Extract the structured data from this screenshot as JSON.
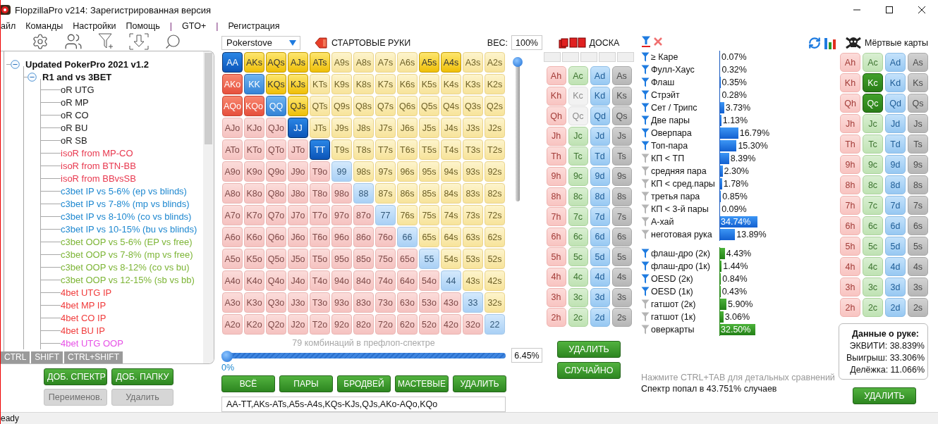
{
  "window": {
    "title": "FlopzillaPro v214: Зарегистрированная версия"
  },
  "menu": [
    {
      "label": "айл",
      "kind": "item"
    },
    {
      "label": "Команды",
      "kind": "item"
    },
    {
      "label": "Настройки",
      "kind": "item"
    },
    {
      "label": "Помощь",
      "kind": "item"
    },
    {
      "label": "|",
      "kind": "separator"
    },
    {
      "label": "GTO+",
      "kind": "item"
    },
    {
      "label": "|",
      "kind": "separator"
    },
    {
      "label": "Регистрация",
      "kind": "item"
    }
  ],
  "tree": {
    "nodes": [
      {
        "label": "Updated PokerPro 2021 v1.2",
        "kind": "folder",
        "expanded": true,
        "children": [
          {
            "label": "R1 and vs 3BET",
            "kind": "folder",
            "expanded": true,
            "children": [
              {
                "label": "oR UTG",
                "kind": "range",
                "color": "#1a1a1a"
              },
              {
                "label": "oR MP",
                "kind": "range",
                "color": "#1a1a1a"
              },
              {
                "label": "oR CO",
                "kind": "range",
                "color": "#1a1a1a"
              },
              {
                "label": "oR BU",
                "kind": "range",
                "color": "#1a1a1a"
              },
              {
                "label": "oR SB",
                "kind": "range",
                "color": "#1a1a1a"
              },
              {
                "label": "isoR from MP-CO",
                "kind": "range",
                "color": "#e8384f"
              },
              {
                "label": "isoR from BTN-BB",
                "kind": "range",
                "color": "#e8384f"
              },
              {
                "label": "isoR from BBvsSB",
                "kind": "range",
                "color": "#e8384f"
              },
              {
                "label": "c3bet IP vs 5-6% (ep vs blinds)",
                "kind": "range",
                "color": "#1e88d0"
              },
              {
                "label": "c3bet IP vs 7-8% (mp vs blinds)",
                "kind": "range",
                "color": "#1e88d0"
              },
              {
                "label": "c3bet IP vs 8-10% (co vs blinds)",
                "kind": "range",
                "color": "#1e88d0"
              },
              {
                "label": "c3bet IP vs 10-15% (bu vs blinds)",
                "kind": "range",
                "color": "#1e88d0"
              },
              {
                "label": "c3bet OOP vs 5-6% (EP vs free)",
                "kind": "range",
                "color": "#7db536"
              },
              {
                "label": "c3bet OOP vs 7-8% (mp vs free)",
                "kind": "range",
                "color": "#7db536"
              },
              {
                "label": "c3bet OOP vs 8-12% (co vs bu)",
                "kind": "range",
                "color": "#7db536"
              },
              {
                "label": "c3bet OOP vs 12-15% (sb vs bb)",
                "kind": "range",
                "color": "#7db536"
              },
              {
                "label": "4bet UTG IP",
                "kind": "range",
                "color": "#f03c3c"
              },
              {
                "label": "4bet MP IP",
                "kind": "range",
                "color": "#f03c3c"
              },
              {
                "label": "4bet CO IP",
                "kind": "range",
                "color": "#f03c3c"
              },
              {
                "label": "4bet BU IP",
                "kind": "range",
                "color": "#f03c3c"
              },
              {
                "label": "4bet UTG OOP",
                "kind": "range",
                "color": "#e650e6"
              }
            ]
          }
        ]
      }
    ],
    "modifier_tabs": [
      "CTRL",
      "SHIFT",
      "CTRL+SHIFT"
    ],
    "buttons": [
      {
        "label": "ДОБ. СПЕКТР",
        "disabled": false
      },
      {
        "label": "ДОБ. ПАПКУ",
        "disabled": false
      },
      {
        "label": "Переименов.",
        "disabled": true
      },
      {
        "label": "Удалить",
        "disabled": true
      }
    ]
  },
  "hands": {
    "preset": "Pokerstove",
    "title": "СТАРТОВЫЕ РУКИ",
    "weight_label": "ВЕС:",
    "weight": "100%",
    "weight_slider": {
      "level": 1
    },
    "rows": [
      [
        {
          "label": "AA",
          "selected": true,
          "emphasized": true
        },
        {
          "label": "AKs",
          "selected": true
        },
        {
          "label": "AQs",
          "selected": true
        },
        {
          "label": "AJs",
          "selected": true
        },
        {
          "label": "ATs",
          "selected": true
        },
        {
          "label": "A9s",
          "selected": false
        },
        {
          "label": "A8s",
          "selected": false
        },
        {
          "label": "A7s",
          "selected": false
        },
        {
          "label": "A6s",
          "selected": false
        },
        {
          "label": "A5s",
          "selected": true
        },
        {
          "label": "A4s",
          "selected": true
        },
        {
          "label": "A3s",
          "selected": false
        },
        {
          "label": "A2s",
          "selected": false
        }
      ],
      [
        {
          "label": "AKo",
          "selected": true
        },
        {
          "label": "KK",
          "selected": true,
          "emphasized": false
        },
        {
          "label": "KQs",
          "selected": true
        },
        {
          "label": "KJs",
          "selected": true
        },
        {
          "label": "KTs",
          "selected": false
        },
        {
          "label": "K9s",
          "selected": false
        },
        {
          "label": "K8s",
          "selected": false
        },
        {
          "label": "K7s",
          "selected": false
        },
        {
          "label": "K6s",
          "selected": false
        },
        {
          "label": "K5s",
          "selected": false
        },
        {
          "label": "K4s",
          "selected": false
        },
        {
          "label": "K3s",
          "selected": false
        },
        {
          "label": "K2s",
          "selected": false
        }
      ],
      [
        {
          "label": "AQo",
          "selected": true
        },
        {
          "label": "KQo",
          "selected": true
        },
        {
          "label": "QQ",
          "selected": true,
          "emphasized": false
        },
        {
          "label": "QJs",
          "selected": true
        },
        {
          "label": "QTs",
          "selected": false
        },
        {
          "label": "Q9s",
          "selected": false
        },
        {
          "label": "Q8s",
          "selected": false
        },
        {
          "label": "Q7s",
          "selected": false
        },
        {
          "label": "Q6s",
          "selected": false
        },
        {
          "label": "Q5s",
          "selected": false
        },
        {
          "label": "Q4s",
          "selected": false
        },
        {
          "label": "Q3s",
          "selected": false
        },
        {
          "label": "Q2s",
          "selected": false
        }
      ],
      [
        {
          "label": "AJo",
          "selected": false
        },
        {
          "label": "KJo",
          "selected": false
        },
        {
          "label": "QJo",
          "selected": false
        },
        {
          "label": "JJ",
          "selected": true,
          "emphasized": true
        },
        {
          "label": "JTs",
          "selected": false
        },
        {
          "label": "J9s",
          "selected": false
        },
        {
          "label": "J8s",
          "selected": false
        },
        {
          "label": "J7s",
          "selected": false
        },
        {
          "label": "J6s",
          "selected": false
        },
        {
          "label": "J5s",
          "selected": false
        },
        {
          "label": "J4s",
          "selected": false
        },
        {
          "label": "J3s",
          "selected": false
        },
        {
          "label": "J2s",
          "selected": false
        }
      ],
      [
        {
          "label": "ATo",
          "selected": false
        },
        {
          "label": "KTo",
          "selected": false
        },
        {
          "label": "QTo",
          "selected": false
        },
        {
          "label": "JTo",
          "selected": false
        },
        {
          "label": "TT",
          "selected": true,
          "emphasized": true
        },
        {
          "label": "T9s",
          "selected": false
        },
        {
          "label": "T8s",
          "selected": false
        },
        {
          "label": "T7s",
          "selected": false
        },
        {
          "label": "T6s",
          "selected": false
        },
        {
          "label": "T5s",
          "selected": false
        },
        {
          "label": "T4s",
          "selected": false
        },
        {
          "label": "T3s",
          "selected": false
        },
        {
          "label": "T2s",
          "selected": false
        }
      ],
      [
        {
          "label": "A9o",
          "selected": false
        },
        {
          "label": "K9o",
          "selected": false
        },
        {
          "label": "Q9o",
          "selected": false
        },
        {
          "label": "J9o",
          "selected": false
        },
        {
          "label": "T9o",
          "selected": false
        },
        {
          "label": "99",
          "selected": false,
          "emphasized": false
        },
        {
          "label": "98s",
          "selected": false
        },
        {
          "label": "97s",
          "selected": false
        },
        {
          "label": "96s",
          "selected": false
        },
        {
          "label": "95s",
          "selected": false
        },
        {
          "label": "94s",
          "selected": false
        },
        {
          "label": "93s",
          "selected": false
        },
        {
          "label": "92s",
          "selected": false
        }
      ],
      [
        {
          "label": "A8o",
          "selected": false
        },
        {
          "label": "K8o",
          "selected": false
        },
        {
          "label": "Q8o",
          "selected": false
        },
        {
          "label": "J8o",
          "selected": false
        },
        {
          "label": "T8o",
          "selected": false
        },
        {
          "label": "98o",
          "selected": false
        },
        {
          "label": "88",
          "selected": false,
          "emphasized": false
        },
        {
          "label": "87s",
          "selected": false
        },
        {
          "label": "86s",
          "selected": false
        },
        {
          "label": "85s",
          "selected": false
        },
        {
          "label": "84s",
          "selected": false
        },
        {
          "label": "83s",
          "selected": false
        },
        {
          "label": "82s",
          "selected": false
        }
      ],
      [
        {
          "label": "A7o",
          "selected": false
        },
        {
          "label": "K7o",
          "selected": false
        },
        {
          "label": "Q7o",
          "selected": false
        },
        {
          "label": "J7o",
          "selected": false
        },
        {
          "label": "T7o",
          "selected": false
        },
        {
          "label": "97o",
          "selected": false
        },
        {
          "label": "87o",
          "selected": false
        },
        {
          "label": "77",
          "selected": false,
          "emphasized": false
        },
        {
          "label": "76s",
          "selected": false
        },
        {
          "label": "75s",
          "selected": false
        },
        {
          "label": "74s",
          "selected": false
        },
        {
          "label": "73s",
          "selected": false
        },
        {
          "label": "72s",
          "selected": false
        }
      ],
      [
        {
          "label": "A6o",
          "selected": false
        },
        {
          "label": "K6o",
          "selected": false
        },
        {
          "label": "Q6o",
          "selected": false
        },
        {
          "label": "J6o",
          "selected": false
        },
        {
          "label": "T6o",
          "selected": false
        },
        {
          "label": "96o",
          "selected": false
        },
        {
          "label": "86o",
          "selected": false
        },
        {
          "label": "76o",
          "selected": false
        },
        {
          "label": "66",
          "selected": false,
          "emphasized": false
        },
        {
          "label": "65s",
          "selected": false
        },
        {
          "label": "64s",
          "selected": false
        },
        {
          "label": "63s",
          "selected": false
        },
        {
          "label": "62s",
          "selected": false
        }
      ],
      [
        {
          "label": "A5o",
          "selected": false
        },
        {
          "label": "K5o",
          "selected": false
        },
        {
          "label": "Q5o",
          "selected": false
        },
        {
          "label": "J5o",
          "selected": false
        },
        {
          "label": "T5o",
          "selected": false
        },
        {
          "label": "95o",
          "selected": false
        },
        {
          "label": "85o",
          "selected": false
        },
        {
          "label": "75o",
          "selected": false
        },
        {
          "label": "65o",
          "selected": false
        },
        {
          "label": "55",
          "selected": false,
          "emphasized": false
        },
        {
          "label": "54s",
          "selected": false
        },
        {
          "label": "53s",
          "selected": false
        },
        {
          "label": "52s",
          "selected": false
        }
      ],
      [
        {
          "label": "A4o",
          "selected": false
        },
        {
          "label": "K4o",
          "selected": false
        },
        {
          "label": "Q4o",
          "selected": false
        },
        {
          "label": "J4o",
          "selected": false
        },
        {
          "label": "T4o",
          "selected": false
        },
        {
          "label": "94o",
          "selected": false
        },
        {
          "label": "84o",
          "selected": false
        },
        {
          "label": "74o",
          "selected": false
        },
        {
          "label": "64o",
          "selected": false
        },
        {
          "label": "54o",
          "selected": false
        },
        {
          "label": "44",
          "selected": false,
          "emphasized": false
        },
        {
          "label": "43s",
          "selected": false
        },
        {
          "label": "42s",
          "selected": false
        }
      ],
      [
        {
          "label": "A3o",
          "selected": false
        },
        {
          "label": "K3o",
          "selected": false
        },
        {
          "label": "Q3o",
          "selected": false
        },
        {
          "label": "J3o",
          "selected": false
        },
        {
          "label": "T3o",
          "selected": false
        },
        {
          "label": "93o",
          "selected": false
        },
        {
          "label": "83o",
          "selected": false
        },
        {
          "label": "73o",
          "selected": false
        },
        {
          "label": "63o",
          "selected": false
        },
        {
          "label": "53o",
          "selected": false
        },
        {
          "label": "43o",
          "selected": false
        },
        {
          "label": "33",
          "selected": false,
          "emphasized": false
        },
        {
          "label": "32s",
          "selected": false
        }
      ],
      [
        {
          "label": "A2o",
          "selected": false
        },
        {
          "label": "K2o",
          "selected": false
        },
        {
          "label": "Q2o",
          "selected": false
        },
        {
          "label": "J2o",
          "selected": false
        },
        {
          "label": "T2o",
          "selected": false
        },
        {
          "label": "92o",
          "selected": false
        },
        {
          "label": "82o",
          "selected": false
        },
        {
          "label": "72o",
          "selected": false
        },
        {
          "label": "62o",
          "selected": false
        },
        {
          "label": "52o",
          "selected": false
        },
        {
          "label": "42o",
          "selected": false
        },
        {
          "label": "32o",
          "selected": false
        },
        {
          "label": "22",
          "selected": false,
          "emphasized": false
        }
      ]
    ],
    "combos_caption": "79 комбинаций в префлоп-спектре",
    "percent_slider": {
      "level": 0
    },
    "slider_min": "0%",
    "percent": "6.45%",
    "buttons": [
      "ВСЁ",
      "ПАРЫ",
      "БРОДВЕЙ",
      "МАСТЕВЫЕ",
      "УДАЛИТЬ"
    ],
    "range_text": "AA-TT,AKs-ATs,A5s-A4s,KQs-KJs,QJs,AKo-AQo,KQo"
  },
  "board": {
    "title": "ДОСКА",
    "cards": [
      [
        {
          "label": "Ah",
          "disabled": false
        },
        {
          "label": "Ac",
          "disabled": false
        },
        {
          "label": "Ad",
          "disabled": false
        },
        {
          "label": "As",
          "disabled": false
        }
      ],
      [
        {
          "label": "Kh",
          "disabled": false
        },
        {
          "label": "Kc",
          "disabled": true
        },
        {
          "label": "Kd",
          "disabled": false
        },
        {
          "label": "Ks",
          "disabled": false
        }
      ],
      [
        {
          "label": "Qh",
          "disabled": false
        },
        {
          "label": "Qc",
          "disabled": true
        },
        {
          "label": "Qd",
          "disabled": false
        },
        {
          "label": "Qs",
          "disabled": false
        }
      ],
      [
        {
          "label": "Jh",
          "disabled": false
        },
        {
          "label": "Jc",
          "disabled": false
        },
        {
          "label": "Jd",
          "disabled": false
        },
        {
          "label": "Js",
          "disabled": false
        }
      ],
      [
        {
          "label": "Th",
          "disabled": false
        },
        {
          "label": "Tc",
          "disabled": false
        },
        {
          "label": "Td",
          "disabled": false
        },
        {
          "label": "Ts",
          "disabled": false
        }
      ],
      [
        {
          "label": "9h",
          "disabled": false
        },
        {
          "label": "9c",
          "disabled": false
        },
        {
          "label": "9d",
          "disabled": false
        },
        {
          "label": "9s",
          "disabled": false
        }
      ],
      [
        {
          "label": "8h",
          "disabled": false
        },
        {
          "label": "8c",
          "disabled": false
        },
        {
          "label": "8d",
          "disabled": false
        },
        {
          "label": "8s",
          "disabled": false
        }
      ],
      [
        {
          "label": "7h",
          "disabled": false
        },
        {
          "label": "7c",
          "disabled": false
        },
        {
          "label": "7d",
          "disabled": false
        },
        {
          "label": "7s",
          "disabled": false
        }
      ],
      [
        {
          "label": "6h",
          "disabled": false
        },
        {
          "label": "6c",
          "disabled": false
        },
        {
          "label": "6d",
          "disabled": false
        },
        {
          "label": "6s",
          "disabled": false
        }
      ],
      [
        {
          "label": "5h",
          "disabled": false
        },
        {
          "label": "5c",
          "disabled": false
        },
        {
          "label": "5d",
          "disabled": false
        },
        {
          "label": "5s",
          "disabled": false
        }
      ],
      [
        {
          "label": "4h",
          "disabled": false
        },
        {
          "label": "4c",
          "disabled": false
        },
        {
          "label": "4d",
          "disabled": false
        },
        {
          "label": "4s",
          "disabled": false
        }
      ],
      [
        {
          "label": "3h",
          "disabled": false
        },
        {
          "label": "3c",
          "disabled": false
        },
        {
          "label": "3d",
          "disabled": false
        },
        {
          "label": "3s",
          "disabled": false
        }
      ],
      [
        {
          "label": "2h",
          "disabled": false
        },
        {
          "label": "2c",
          "disabled": false
        },
        {
          "label": "2d",
          "disabled": false
        },
        {
          "label": "2s",
          "disabled": false
        }
      ]
    ],
    "buttons": [
      "УДАЛИТЬ",
      "СЛУЧАЙНО"
    ]
  },
  "stats": {
    "made": [
      {
        "label": "≥ Каре",
        "value": "0.07%",
        "level": 0.0007,
        "filter_on": true
      },
      {
        "label": "Фулл-Хаус",
        "value": "0.32%",
        "level": 0.0032,
        "filter_on": true
      },
      {
        "label": "Флаш",
        "value": "0.35%",
        "level": 0.0035,
        "filter_on": true
      },
      {
        "label": "Стрэйт",
        "value": "0.28%",
        "level": 0.0028,
        "filter_on": true
      },
      {
        "label": "Сет / Трипс",
        "value": "3.73%",
        "level": 0.0373,
        "filter_on": true
      },
      {
        "label": "Две пары",
        "value": "1.13%",
        "level": 0.0113,
        "filter_on": true
      },
      {
        "label": "Оверпара",
        "value": "16.79%",
        "level": 0.1679,
        "filter_on": true
      },
      {
        "label": "Топ-пара",
        "value": "15.30%",
        "level": 0.153,
        "filter_on": true
      },
      {
        "label": "КП < ТП",
        "value": "8.39%",
        "level": 0.0839,
        "filter_on": false
      },
      {
        "label": "средняя пара",
        "value": "2.30%",
        "level": 0.023,
        "filter_on": false
      },
      {
        "label": "КП < сред.пары",
        "value": "1.78%",
        "level": 0.0178,
        "filter_on": false
      },
      {
        "label": "третья пара",
        "value": "0.85%",
        "level": 0.0085,
        "filter_on": false
      },
      {
        "label": "КП < 3-й пары",
        "value": "0.09%",
        "level": 0.0009,
        "filter_on": false
      },
      {
        "label": "А-хай",
        "value": "34.74%",
        "level": 0.3474,
        "filter_on": false
      },
      {
        "label": "неготовая рука",
        "value": "13.89%",
        "level": 0.1389,
        "filter_on": false
      }
    ],
    "draws": [
      {
        "label": "флаш-дро (2к)",
        "value": "4.43%",
        "level": 0.0443,
        "filter_on": true
      },
      {
        "label": "флаш-дро (1к)",
        "value": "1.44%",
        "level": 0.0144,
        "filter_on": true
      },
      {
        "label": "OESD (2к)",
        "value": "0.84%",
        "level": 0.0084,
        "filter_on": true
      },
      {
        "label": "OESD (1к)",
        "value": "0.43%",
        "level": 0.0043,
        "filter_on": true
      },
      {
        "label": "гатшот (2к)",
        "value": "5.90%",
        "level": 0.059,
        "filter_on": false
      },
      {
        "label": "гатшот (1к)",
        "value": "3.06%",
        "level": 0.0306,
        "filter_on": false
      },
      {
        "label": "оверкарты",
        "value": "32.50%",
        "level": 0.325,
        "filter_on": false
      }
    ],
    "hint": "Нажмите CTRL+TAB для детальных сравнений",
    "hit_rate": "Спектр попал в 43.751% случаев"
  },
  "dead_cards": {
    "title": "Мёртвые карты",
    "cards": [
      [
        {
          "label": "Ah",
          "selected": false
        },
        {
          "label": "Ac",
          "selected": false
        },
        {
          "label": "Ad",
          "selected": false
        },
        {
          "label": "As",
          "selected": false
        }
      ],
      [
        {
          "label": "Kh",
          "selected": false
        },
        {
          "label": "Kc",
          "selected": true
        },
        {
          "label": "Kd",
          "selected": false
        },
        {
          "label": "Ks",
          "selected": false
        }
      ],
      [
        {
          "label": "Qh",
          "selected": false
        },
        {
          "label": "Qc",
          "selected": true
        },
        {
          "label": "Qd",
          "selected": false
        },
        {
          "label": "Qs",
          "selected": false
        }
      ],
      [
        {
          "label": "Jh",
          "selected": false
        },
        {
          "label": "Jc",
          "selected": false
        },
        {
          "label": "Jd",
          "selected": false
        },
        {
          "label": "Js",
          "selected": false
        }
      ],
      [
        {
          "label": "Th",
          "selected": false
        },
        {
          "label": "Tc",
          "selected": false
        },
        {
          "label": "Td",
          "selected": false
        },
        {
          "label": "Ts",
          "selected": false
        }
      ],
      [
        {
          "label": "9h",
          "selected": false
        },
        {
          "label": "9c",
          "selected": false
        },
        {
          "label": "9d",
          "selected": false
        },
        {
          "label": "9s",
          "selected": false
        }
      ],
      [
        {
          "label": "8h",
          "selected": false
        },
        {
          "label": "8c",
          "selected": false
        },
        {
          "label": "8d",
          "selected": false
        },
        {
          "label": "8s",
          "selected": false
        }
      ],
      [
        {
          "label": "7h",
          "selected": false
        },
        {
          "label": "7c",
          "selected": false
        },
        {
          "label": "7d",
          "selected": false
        },
        {
          "label": "7s",
          "selected": false
        }
      ],
      [
        {
          "label": "6h",
          "selected": false
        },
        {
          "label": "6c",
          "selected": false
        },
        {
          "label": "6d",
          "selected": false
        },
        {
          "label": "6s",
          "selected": false
        }
      ],
      [
        {
          "label": "5h",
          "selected": false
        },
        {
          "label": "5c",
          "selected": false
        },
        {
          "label": "5d",
          "selected": false
        },
        {
          "label": "5s",
          "selected": false
        }
      ],
      [
        {
          "label": "4h",
          "selected": false
        },
        {
          "label": "4c",
          "selected": false
        },
        {
          "label": "4d",
          "selected": false
        },
        {
          "label": "4s",
          "selected": false
        }
      ],
      [
        {
          "label": "3h",
          "selected": false
        },
        {
          "label": "3c",
          "selected": false
        },
        {
          "label": "3d",
          "selected": false
        },
        {
          "label": "3s",
          "selected": false
        }
      ],
      [
        {
          "label": "2h",
          "selected": false
        },
        {
          "label": "2c",
          "selected": false
        },
        {
          "label": "2d",
          "selected": false
        },
        {
          "label": "2s",
          "selected": false
        }
      ]
    ],
    "info_title": "Данные о руке:",
    "info_lines": [
      "ЭКВИТИ: 38.839%",
      "Выигрыш: 33.306%",
      "Делёжка: 11.066%"
    ],
    "button": "УДАЛИТЬ"
  },
  "status_bar": "eady"
}
